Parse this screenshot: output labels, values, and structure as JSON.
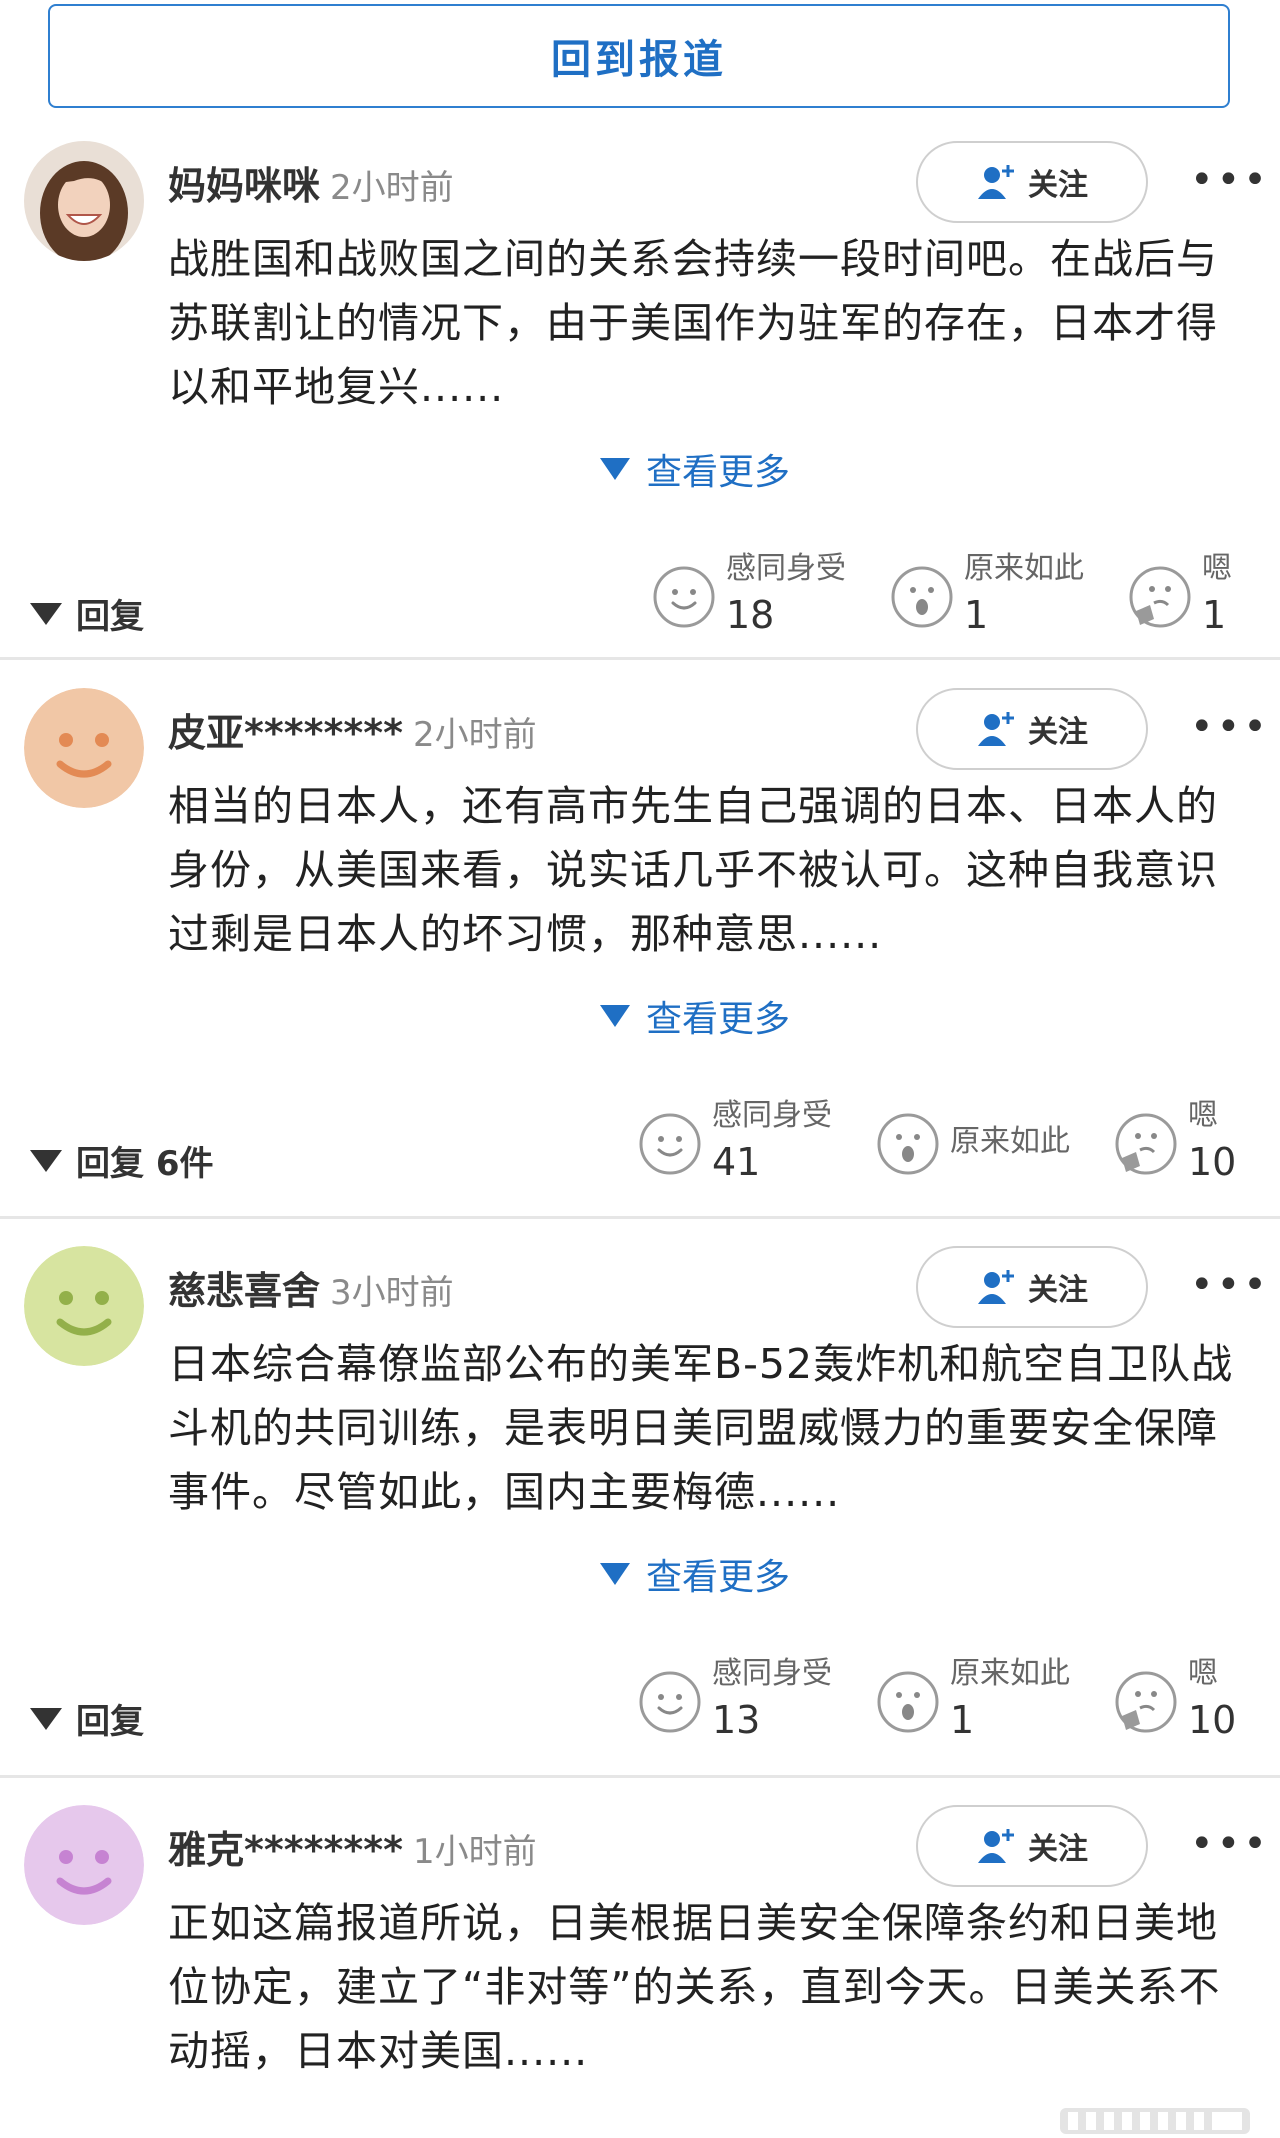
{
  "back_button": "回到报道",
  "follow_label": "关注",
  "see_more_label": "查看更多",
  "more_label": "•••",
  "colors": {
    "accent": "#1f6fc4",
    "divider": "#e6e6e6"
  },
  "comments": [
    {
      "author": "妈妈咪咪",
      "time": "2小时前",
      "text": "战胜国和战败国之间的关系会持续一段时间吧。在战后与苏联割让的情况下，由于美国作为驻军的存在，日本才得以和平地复兴......",
      "reply_label": "回复",
      "reactions": [
        {
          "label": "感同身受",
          "count": "18"
        },
        {
          "label": "原来如此",
          "count": "1"
        },
        {
          "label": "嗯",
          "count": "1"
        }
      ]
    },
    {
      "author": "皮亚********",
      "time": "2小时前",
      "text": "相当的日本人，还有高市先生自己强调的日本、日本人的身份，从美国来看，说实话几乎不被认可。这种自我意识过剩是日本人的坏习惯，那种意思......",
      "reply_label": "回复 6件",
      "reactions": [
        {
          "label": "感同身受",
          "count": "41"
        },
        {
          "label": "原来如此",
          "count": ""
        },
        {
          "label": "嗯",
          "count": "10"
        }
      ]
    },
    {
      "author": "慈悲喜舍",
      "time": "3小时前",
      "text": "日本综合幕僚监部公布的美军B-52轰炸机和航空自卫队战斗机的共同训练，是表明日美同盟威慑力的重要安全保障事件。尽管如此，国内主要梅德......",
      "reply_label": "回复",
      "reactions": [
        {
          "label": "感同身受",
          "count": "13"
        },
        {
          "label": "原来如此",
          "count": "1"
        },
        {
          "label": "嗯",
          "count": "10"
        }
      ]
    },
    {
      "author": "雅克********",
      "time": "1小时前",
      "text": "正如这篇报道所说，日美根据日美安全保障条约和日美地位协定，建立了“非对等”的关系，直到今天。日美关系不动摇，日本对美国......"
    }
  ]
}
